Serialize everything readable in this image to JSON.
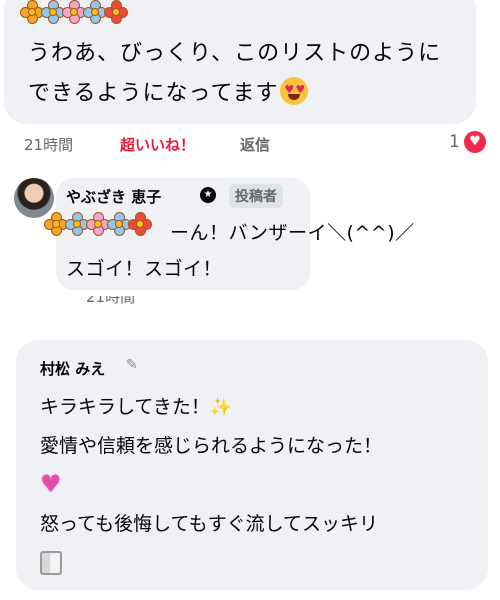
{
  "comments": [
    {
      "author": "",
      "text_line1": "うわあ、びっくり、このリストのように",
      "text_line2": "できるようになってます",
      "emoji": "heart-eyes-emoji",
      "time": "21時間",
      "reaction_label": "超いいね！",
      "reply_label": "返信",
      "reaction_count": "1",
      "reaction_icon": "heart-icon",
      "colors": {
        "superlike": "#e41e3f",
        "heart": "#f0284a"
      }
    },
    {
      "author": "やぶざき 恵子",
      "badge_icon": "shield-star-icon",
      "role_badge": "投稿者",
      "text_line1": "ーん！バンザーイ＼(^^)／",
      "text_line2": "スゴイ！スゴイ！",
      "time": "21時間"
    },
    {
      "author": "村松 みえ",
      "author_icon": "leaf-icon",
      "line1": "キラキラしてきた！",
      "sparkle_emoji": "sparkles-emoji",
      "line2": "愛情や信頼を感じられるようになった！",
      "heart_emoji": "sparkling-heart-emoji",
      "line3": "怒っても後悔してもすぐ流してスッキリ",
      "toilet_paper_emoji": "toilet-paper-emoji"
    }
  ],
  "stickers": {
    "icon": "flower-sticker-icon",
    "count": 5
  }
}
